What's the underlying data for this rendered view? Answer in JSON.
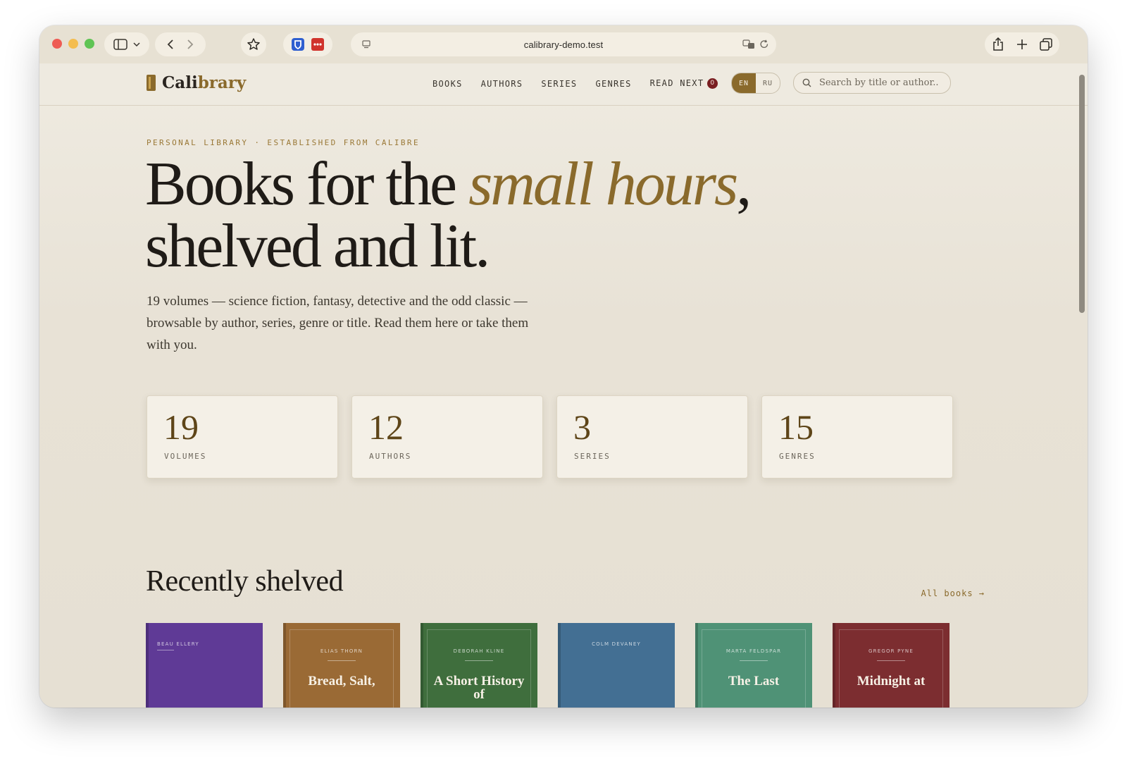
{
  "browser": {
    "url": "calibrary-demo.test"
  },
  "nav": {
    "logo_prefix": "Cali",
    "logo_suffix": "brary",
    "items": [
      {
        "label": "BOOKS"
      },
      {
        "label": "AUTHORS"
      },
      {
        "label": "SERIES"
      },
      {
        "label": "GENRES"
      },
      {
        "label": "READ NEXT"
      }
    ],
    "read_next_count": "0",
    "lang": {
      "active": "EN",
      "other": "RU"
    },
    "search_placeholder": "Search by title or author.."
  },
  "hero": {
    "eyebrow": "PERSONAL LIBRARY · ESTABLISHED FROM CALIBRE",
    "title_start": "Books for the ",
    "title_emphasis": "small hours",
    "title_comma": ",",
    "title_end": "shelved and lit.",
    "lede": "19 volumes — science fiction, fantasy, detective and the odd classic — browsable by author, series, genre or title. Read them here or take them with you."
  },
  "stats": [
    {
      "value": "19",
      "label": "VOLUMES"
    },
    {
      "value": "12",
      "label": "AUTHORS"
    },
    {
      "value": "3",
      "label": "SERIES"
    },
    {
      "value": "15",
      "label": "GENRES"
    }
  ],
  "recent": {
    "title": "Recently shelved",
    "all_books_link": "All books →",
    "books": [
      {
        "author": "BEAU ELLERY",
        "title": "",
        "color": "#5f3a96"
      },
      {
        "author": "ELIAS THORN",
        "title": "Bread, Salt,",
        "color": "#9a6a35"
      },
      {
        "author": "DEBORAH KLINE",
        "title": "A Short History of",
        "color": "#3f6e3d"
      },
      {
        "author": "COLM DEVANEY",
        "title": "",
        "color": "#436f93"
      },
      {
        "author": "MARTA FELDSPAR",
        "title": "The Last",
        "color": "#4f9276"
      },
      {
        "author": "GREGOR PYNE",
        "title": "Midnight at",
        "color": "#7c2d30"
      }
    ]
  },
  "colors": {
    "accent": "#8a6a2c",
    "background": "#e9e3d6",
    "badge": "#7a1f22"
  }
}
